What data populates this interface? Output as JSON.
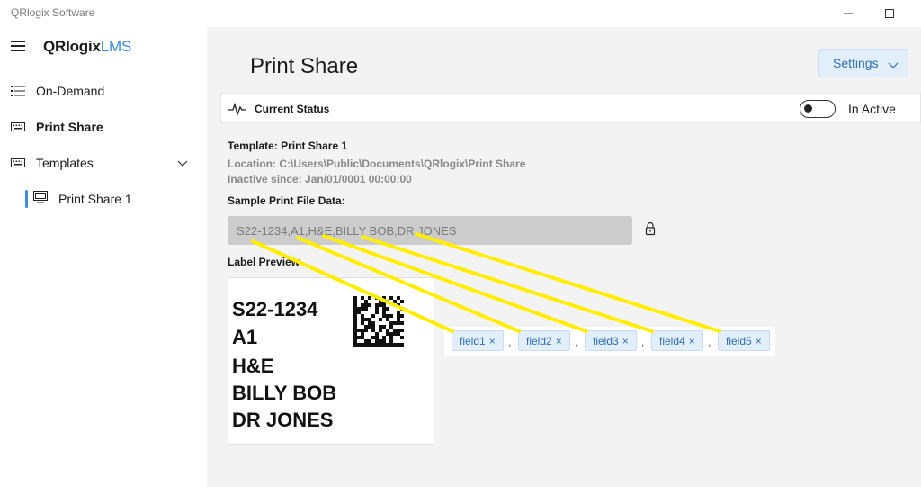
{
  "app": {
    "title": "QRlogix Software"
  },
  "logo": {
    "brand": "QRlogix",
    "suffix": "LMS"
  },
  "sidebar": {
    "items": [
      {
        "label": "On-Demand",
        "icon": "list-icon"
      },
      {
        "label": "Print Share",
        "icon": "keyboard-icon",
        "active": true
      },
      {
        "label": "Templates",
        "icon": "keyboard-icon",
        "expanded": true
      }
    ],
    "subitems": [
      {
        "label": "Print Share 1",
        "icon": "monitor-icon",
        "selected": true
      }
    ]
  },
  "main": {
    "title": "Print Share",
    "settings_label": "Settings",
    "status": {
      "label": "Current Status",
      "toggle_label": "In Active",
      "toggle_on": false
    },
    "template": {
      "name": "Template: Print Share 1",
      "location": "Location: C:\\Users\\Public\\Documents\\QRlogix\\Print Share",
      "inactive_since": "Inactive since: Jan/01/0001 00:00:00"
    },
    "sample_label": "Sample Print File Data:",
    "sample_value": "S22-1234,A1,H&E,BILLY BOB,DR JONES",
    "preview_label": "Label Preview",
    "preview_lines": [
      "S22-1234",
      "A1",
      "H&E",
      "BILLY BOB",
      "DR JONES"
    ],
    "fields": [
      "field1",
      "field2",
      "field3",
      "field4",
      "field5"
    ],
    "separator": ",",
    "chip_close": "×",
    "highlight_color": "#ffee00",
    "accent_color": "#3b8de0"
  }
}
